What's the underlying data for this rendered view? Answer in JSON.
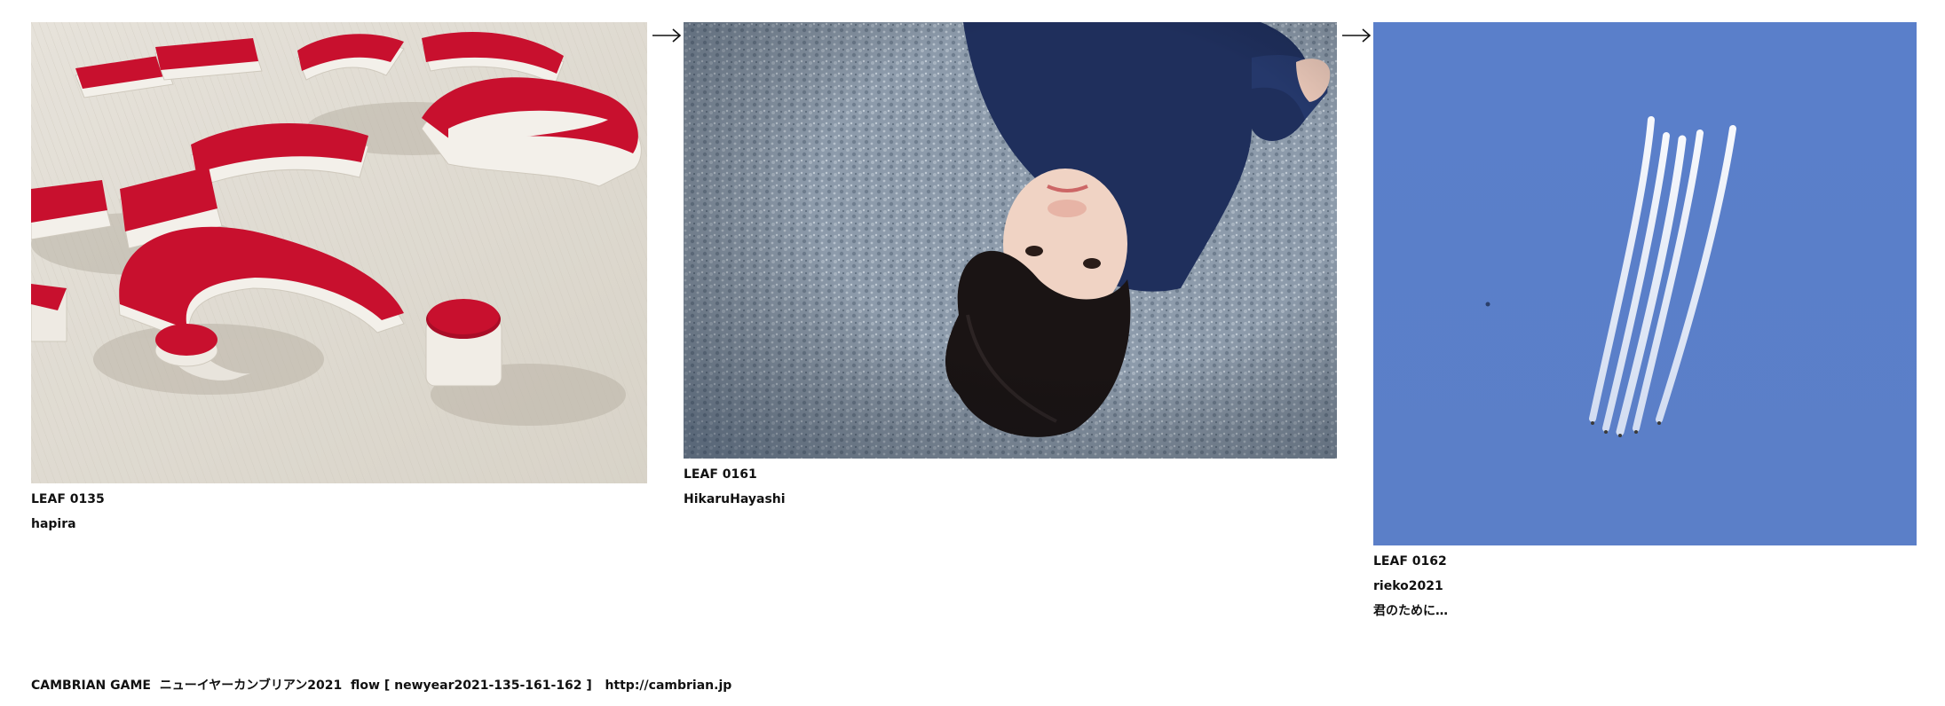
{
  "leaves": [
    {
      "number": "LEAF 0135",
      "author": "hapira",
      "caption": "",
      "image_alt": "photo-red-white-3d-letters"
    },
    {
      "number": "LEAF 0161",
      "author": "HikaruHayashi",
      "caption": "",
      "image_alt": "photo-child-lying-on-ground"
    },
    {
      "number": "LEAF 0162",
      "author": "rieko2021",
      "caption": "君のために…",
      "image_alt": "photo-contrails-blue-sky"
    }
  ],
  "arrows": [
    "arrow-right-icon",
    "arrow-right-icon"
  ],
  "footer": {
    "brand": "CAMBRIAN GAME",
    "title": "ニューイヤーカンブリアン2021",
    "flow": "flow [ newyear2021-135-161-162 ]",
    "url": "http://cambrian.jp"
  },
  "colors": {
    "letter_red": "#c8102e",
    "sky_blue": "#5b80c8",
    "ground_grey": "#8a99a8",
    "shirt_navy": "#1f2f5c"
  }
}
